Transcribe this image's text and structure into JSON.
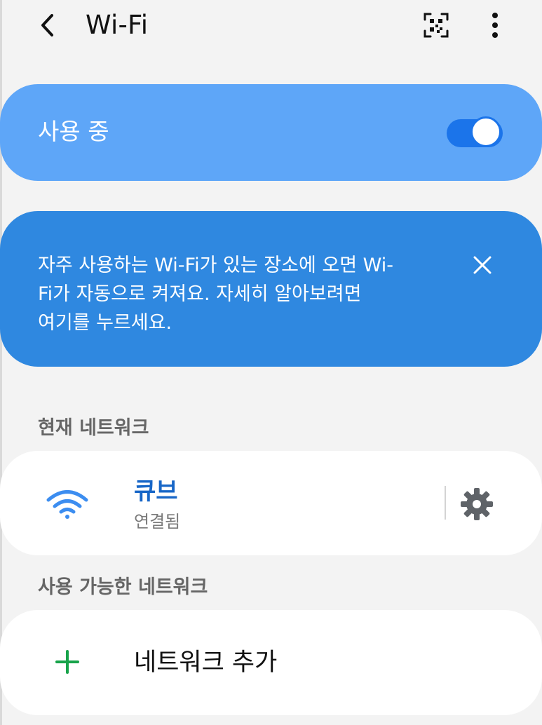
{
  "header": {
    "title": "Wi-Fi",
    "back_icon": "chevron-left-icon",
    "qr_icon": "qr-code-icon",
    "more_icon": "more-vertical-icon"
  },
  "toggle": {
    "label": "사용 중",
    "state": "on"
  },
  "tip": {
    "text": "자주 사용하는 Wi-Fi가 있는 장소에 오면 Wi-\nFi가 자동으로 켜져요. 자세히 알아보려면\n여기를 누르세요.",
    "close_icon": "close-icon"
  },
  "sections": {
    "current": "현재 네트워크",
    "available": "사용 가능한 네트워크"
  },
  "current_network": {
    "name": "큐브",
    "status": "연결됨",
    "wifi_icon": "wifi-icon",
    "settings_icon": "gear-icon"
  },
  "add_network": {
    "label": "네트워크 추가",
    "icon": "plus-icon"
  },
  "colors": {
    "background": "#f3f3f3",
    "toggle_card": "#5ea6f8",
    "switch": "#1b74ea",
    "tip_card": "#2f88e0",
    "network_blue": "#1766c7",
    "section_gray": "#666666",
    "status_gray": "#7a7a7a",
    "plus_green": "#17a34a"
  }
}
